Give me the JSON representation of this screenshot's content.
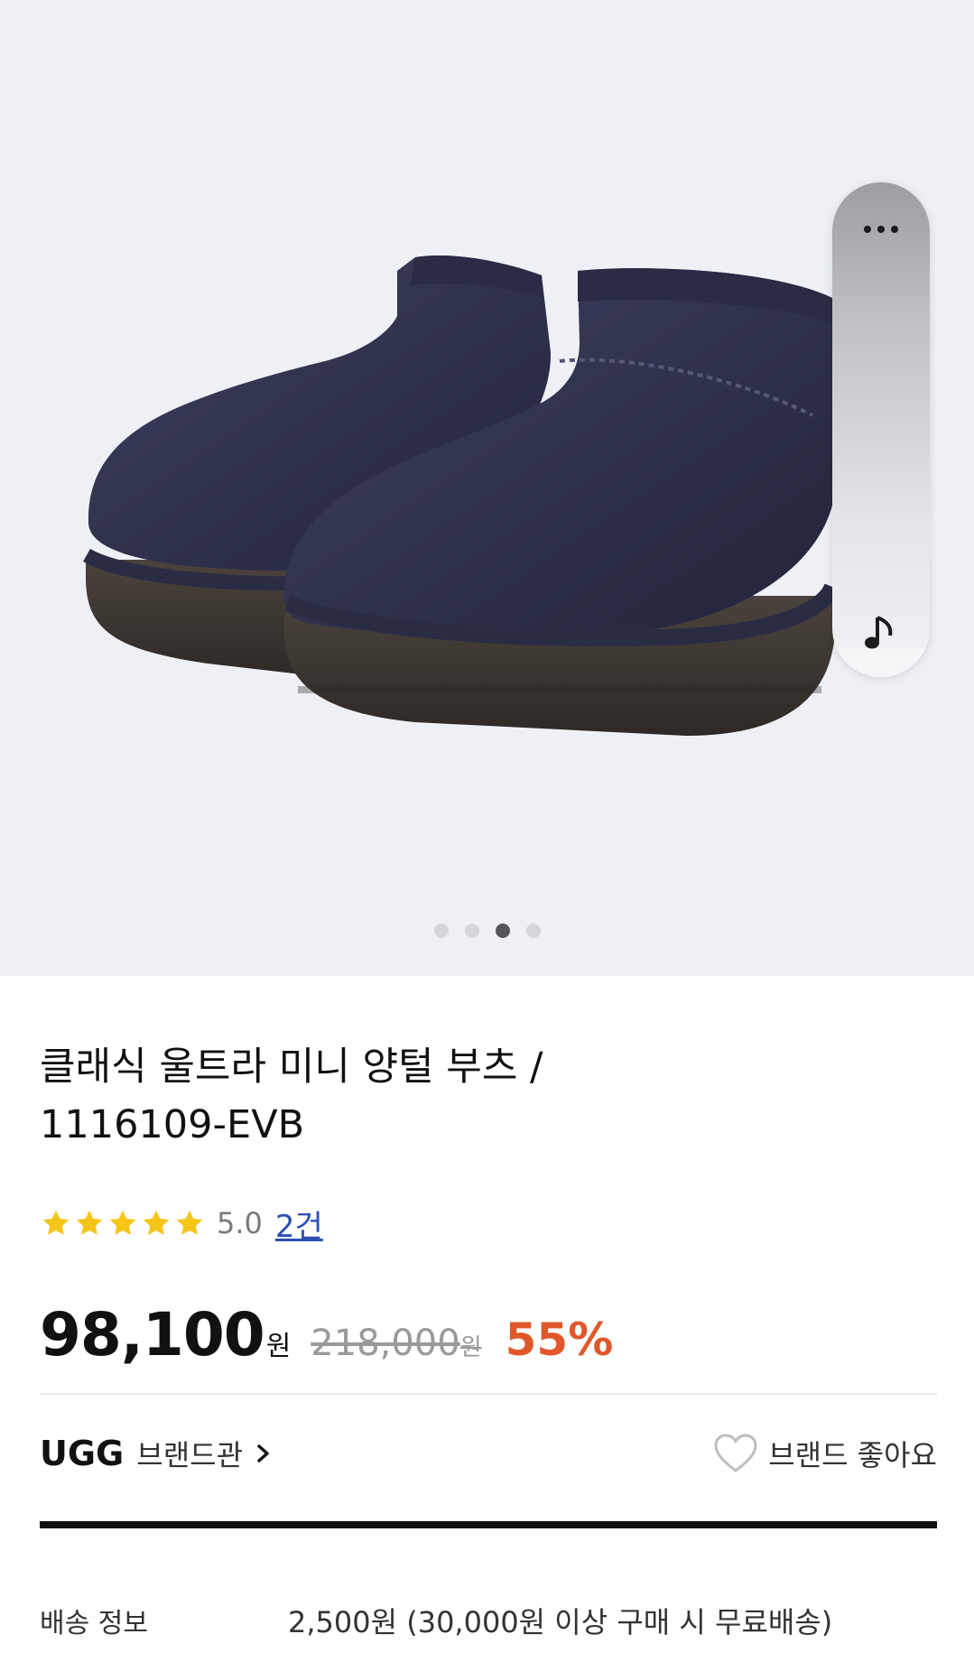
{
  "gallery": {
    "image_alt": "Navy suede mini sheepskin boots",
    "slide_count": 4,
    "active_slide": 3
  },
  "floating_panel": {
    "more_icon": "more-horizontal-icon",
    "music_icon": "music-note-icon"
  },
  "product": {
    "title_line1": "클래식 울트라 미니 양털 부츠 /",
    "title_line2": "1116109-EVB",
    "rating_stars": 5,
    "rating_score": "5.0",
    "review_count": "2건"
  },
  "price": {
    "sale_price": "98,100",
    "sale_unit": "원",
    "original_price": "218,000",
    "original_unit": "원",
    "discount": "55%"
  },
  "brand": {
    "name": "UGG",
    "shop_label": "브랜드관",
    "like_label": "브랜드 좋아요"
  },
  "shipping": {
    "label": "배송 정보",
    "value": "2,500원 (30,000원 이상 구매 시 무료배송)"
  },
  "colors": {
    "accent_discount": "#e0582a",
    "link_blue": "#2d4fb6",
    "star_yellow": "#f5c518",
    "hero_background": "#eef0f6"
  }
}
